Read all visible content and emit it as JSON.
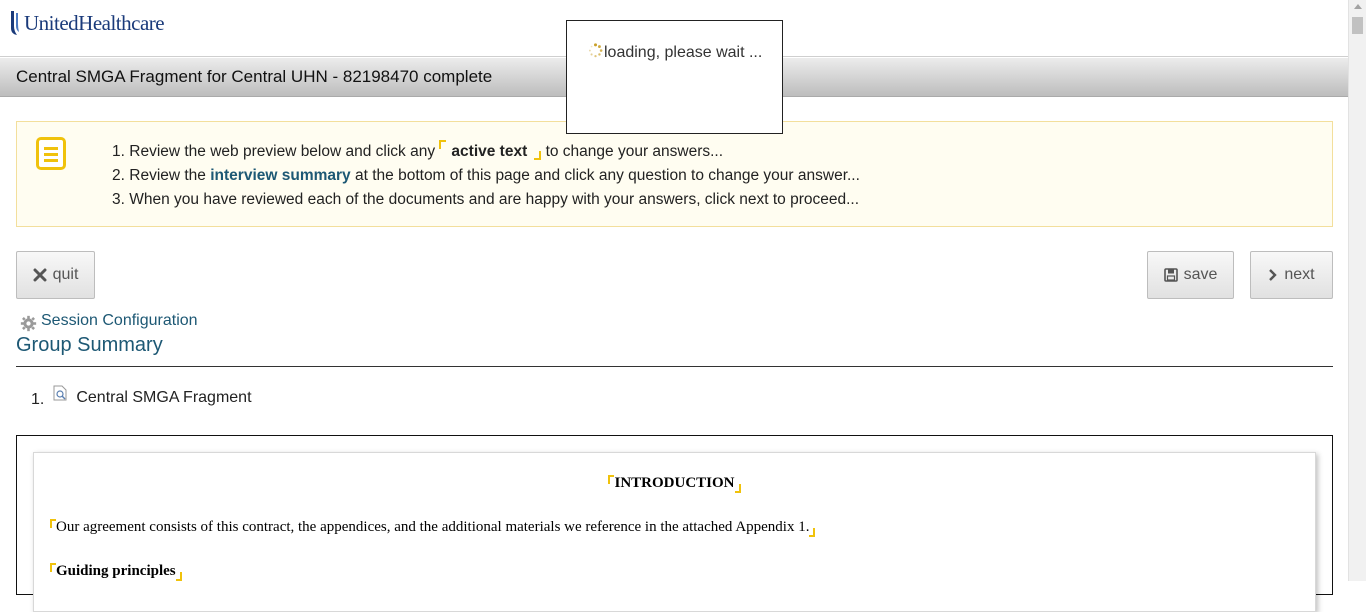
{
  "brand": {
    "name": "UnitedHealthcare"
  },
  "header": {
    "title": "Central SMGA Fragment for Central UHN - 82198470 complete"
  },
  "notice": {
    "step1_num": "1.",
    "step1_a": "Review the web preview below and click any",
    "step1_active": "active text",
    "step1_b": "to change your answers...",
    "step2_num": "2.",
    "step2_a": "Review the",
    "step2_link": "interview summary",
    "step2_b": "at the bottom of this page and click any question to change your answer...",
    "step3_num": "3.",
    "step3_text": "When you have reviewed each of the documents and are happy with your answers, click next to proceed..."
  },
  "toolbar": {
    "quit_label": "quit",
    "save_label": "save",
    "next_label": "next"
  },
  "session": {
    "label": "Session Configuration"
  },
  "group": {
    "title": "Group Summary",
    "items": [
      {
        "num": "1.",
        "label": "Central SMGA Fragment"
      }
    ]
  },
  "preview": {
    "heading": "INTRODUCTION",
    "paragraph": "Our agreement consists of this contract, the appendices, and the additional materials we reference in the attached Appendix 1.",
    "subheading": "Guiding principles"
  },
  "loading": {
    "text": "loading, please wait ..."
  },
  "icons": {
    "note": "note-icon",
    "quit": "close-x-icon",
    "save": "floppy-disk-icon",
    "next": "chevron-right-icon",
    "session": "gear-icon",
    "document": "document-icon",
    "spinner": "spinner-icon"
  },
  "colors": {
    "accent_yellow": "#f0c20c",
    "link_blue": "#1d5874",
    "brand_blue": "#1a3a7a"
  }
}
